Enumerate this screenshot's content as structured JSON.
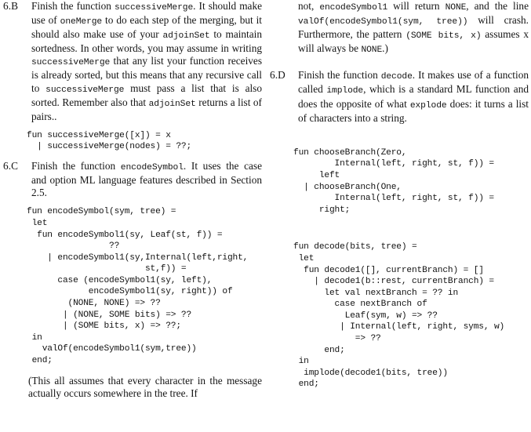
{
  "document": {
    "kind": "textbook-exercise-page",
    "columns": 2
  },
  "left_column": {
    "items": [
      {
        "label": "6.B",
        "paragraph_runs": [
          {
            "t": "Finish the function ",
            "mono": false
          },
          {
            "t": "successiveMerge",
            "mono": true
          },
          {
            "t": ". It should make use of ",
            "mono": false
          },
          {
            "t": "oneMerge",
            "mono": true
          },
          {
            "t": " to do each step of the merging, but it should also make use of your ",
            "mono": false
          },
          {
            "t": "adjoinSet",
            "mono": true
          },
          {
            "t": " to maintain sortedness. In other words, you may assume in writing ",
            "mono": false
          },
          {
            "t": "successiveMerge",
            "mono": true
          },
          {
            "t": " that any list your function receives is already sorted, but this means that any recursive call to ",
            "mono": false
          },
          {
            "t": "successiveMerge",
            "mono": true
          },
          {
            "t": " must pass a list that is also sorted. Remember also that ",
            "mono": false
          },
          {
            "t": "adjoinSet",
            "mono": true
          },
          {
            "t": " returns a list of pairs..",
            "mono": false
          }
        ],
        "code": "fun successiveMerge([x]) = x\n  | successiveMerge(nodes) = ??;"
      },
      {
        "label": "6.C",
        "paragraph_runs": [
          {
            "t": "Finish the function ",
            "mono": false
          },
          {
            "t": "encodeSymbol",
            "mono": true
          },
          {
            "t": ". It uses the case and option ML language features described in Section 2.5.",
            "mono": false
          }
        ],
        "code": "fun encodeSymbol(sym, tree) =\n let\n  fun encodeSymbol1(sy, Leaf(st, f)) =\n                ??\n    | encodeSymbol1(sy,Internal(left,right,\n                       st,f)) =\n      case (encodeSymbol1(sy, left),\n            encodeSymbol1(sy, right)) of\n        (NONE, NONE) => ??\n       | (NONE, SOME bits) => ??\n       | (SOME bits, x) => ??;\n in\n   valOf(encodeSymbol1(sym,tree))\n end;",
        "note": "(This all assumes that every character in the message actually occurs somewhere in the tree.  If"
      }
    ]
  },
  "right_column": {
    "continuation_runs": [
      {
        "t": "not, ",
        "mono": false
      },
      {
        "t": "encodeSymbol1",
        "mono": true
      },
      {
        "t": " will return ",
        "mono": false
      },
      {
        "t": "NONE",
        "mono": true
      },
      {
        "t": ", and the line ",
        "mono": false
      },
      {
        "t": "valOf(encodeSymbol1(sym, tree))",
        "mono": true
      },
      {
        "t": " will crash. Furthermore, the pattern ",
        "mono": false
      },
      {
        "t": "(SOME bits, x)",
        "mono": true
      },
      {
        "t": " assumes x will always be ",
        "mono": false
      },
      {
        "t": "NONE",
        "mono": true
      },
      {
        "t": ".)",
        "mono": false
      }
    ],
    "items": [
      {
        "label": "6.D",
        "paragraph_runs": [
          {
            "t": "Finish the function ",
            "mono": false
          },
          {
            "t": "decode",
            "mono": true
          },
          {
            "t": ". It makes use of a function called ",
            "mono": false
          },
          {
            "t": "implode",
            "mono": true
          },
          {
            "t": ", which is a standard ML function and does the opposite of what ",
            "mono": false
          },
          {
            "t": "explode",
            "mono": true
          },
          {
            "t": " does: it turns a list of characters into a string.",
            "mono": false
          }
        ],
        "code_a": "fun chooseBranch(Zero,\n        Internal(left, right, st, f)) =\n     left\n  | chooseBranch(One,\n        Internal(left, right, st, f)) =\n     right;",
        "code_b": "fun decode(bits, tree) =\n let\n  fun decode1([], currentBranch) = []\n    | decode1(b::rest, currentBranch) =\n      let val nextBranch = ?? in\n        case nextBranch of\n          Leaf(sym, w) => ??\n         | Internal(left, right, syms, w)\n            => ??\n      end;\n in\n  implode(decode1(bits, tree))\n end;"
      }
    ]
  }
}
